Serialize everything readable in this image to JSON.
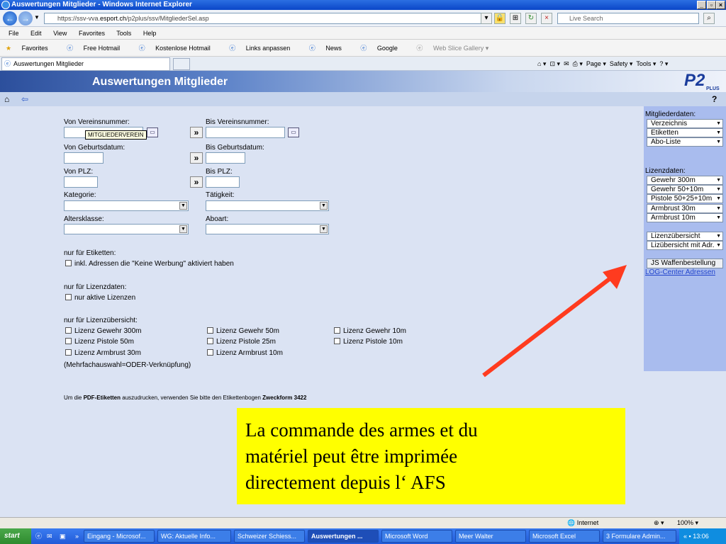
{
  "window": {
    "title": "Auswertungen Mitglieder - Windows Internet Explorer"
  },
  "address": {
    "url_prefix": "https://ssv-vva.",
    "url_host": "esport.ch",
    "url_path": "/p2plus/ssv/MitgliederSel.asp",
    "search_placeholder": "Live Search"
  },
  "menu": [
    "File",
    "Edit",
    "View",
    "Favorites",
    "Tools",
    "Help"
  ],
  "favorites": [
    "Favorites",
    "Free Hotmail",
    "Kostenlose Hotmail",
    "Links anpassen",
    "News",
    "Google",
    "Web Slice Gallery ▾"
  ],
  "tab": {
    "label": "Auswertungen Mitglieder"
  },
  "commandbar": [
    "Page ▾",
    "Safety ▾",
    "Tools ▾"
  ],
  "header": {
    "title": "Auswertungen Mitglieder",
    "logo": "P2",
    "logo_sub": "PLUS",
    "help": "?"
  },
  "form": {
    "von_vereinsnummer": "Von Vereinsnummer:",
    "bis_vereinsnummer": "Bis Vereinsnummer:",
    "tooltip": "MITGLIEDERVEREIN",
    "von_geburtsdatum": "Von Geburtsdatum:",
    "bis_geburtsdatum": "Bis Geburtsdatum:",
    "von_plz": "Von PLZ:",
    "bis_plz": "Bis PLZ:",
    "kategorie": "Kategorie:",
    "taetigkeit": "Tätigkeit:",
    "altersklasse": "Altersklasse:",
    "aboart": "Aboart:",
    "copy_btn": "»",
    "etiketten_heading": "nur für Etiketten:",
    "etiketten_cb": "inkl. Adressen die \"Keine Werbung\" aktiviert haben",
    "lizenzdaten_heading": "nur für Lizenzdaten:",
    "lizenzdaten_cb": "nur aktive Lizenzen",
    "lizenz_heading": "nur für Lizenzübersicht:",
    "lizenz_cbs": [
      "Lizenz Gewehr 300m",
      "Lizenz Gewehr 50m",
      "Lizenz Gewehr 10m",
      "Lizenz Pistole 50m",
      "Lizenz Pistole 25m",
      "Lizenz Pistole 10m",
      "Lizenz Armbrust 30m",
      "Lizenz Armbrust 10m"
    ],
    "mehrfach": "(Mehrfachauswahl=ODER-Verknüpfung)",
    "footnote_pre": "Um die ",
    "footnote_bold1": "PDF-Etiketten",
    "footnote_mid": " auszudrucken, verwenden Sie bitte den Etikettenbogen ",
    "footnote_bold2": "Zweckform 3422"
  },
  "sidebar": {
    "mitglieder_heading": "Mitgliederdaten:",
    "mitglieder": [
      "Verzeichnis",
      "Etiketten",
      "Abo-Liste"
    ],
    "lizenz_heading": "Lizenzdaten:",
    "lizenz": [
      "Gewehr 300m",
      "Gewehr 50+10m",
      "Pistole 50+25+10m",
      "Armbrust 30m",
      "Armbrust 10m"
    ],
    "uebersicht": [
      "Lizenzübersicht",
      "Lizübersicht mit Adr."
    ],
    "waffen_btn": "JS Waffenbestellung",
    "log_link": "LOG-Center Adressen"
  },
  "callout": {
    "line1": "La commande des armes et du",
    "line2": "matériel peut être imprimée",
    "line3": "directement depuis l‘ AFS"
  },
  "status": {
    "zone": "Internet",
    "zoom": "100%"
  },
  "taskbar": {
    "start": "start",
    "tasks": [
      "Eingang - Microsof...",
      "WG: Aktuelle Info...",
      "Schweizer Schiess...",
      "Auswertungen ...",
      "Microsoft Word",
      "Meer Walter",
      "Microsoft Excel",
      "3 Formulare Admin..."
    ],
    "clock": "13:06"
  },
  "colors": {
    "arrow": "#ff3b1f",
    "callout_bg": "#ffff00",
    "sidebar_bg": "#a9bcee",
    "page_bg": "#dbe3f3"
  }
}
